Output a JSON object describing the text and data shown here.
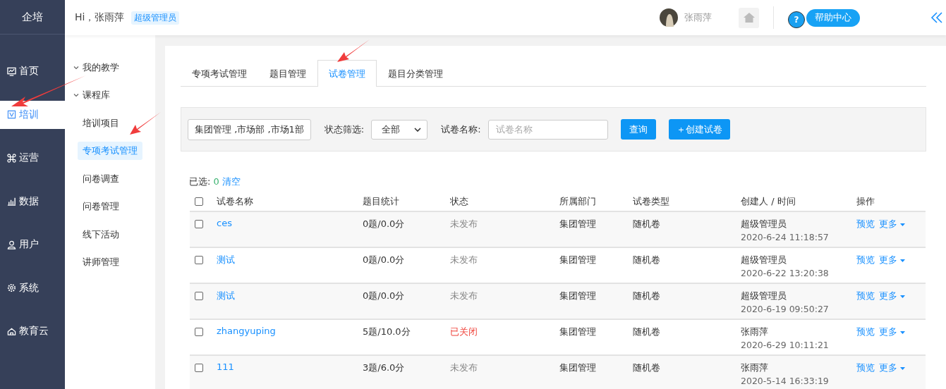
{
  "logo": "企培",
  "header": {
    "greeting": "Hi，张雨萍",
    "role_badge": "超级管理员",
    "user_name": "张雨萍",
    "help_mark": "?",
    "help": "帮助中心"
  },
  "nav": [
    {
      "label": "首页",
      "selected": false
    },
    {
      "label": "培训",
      "selected": true
    },
    {
      "label": "运营",
      "selected": false
    },
    {
      "label": "数据",
      "selected": false
    },
    {
      "label": "用户",
      "selected": false
    },
    {
      "label": "系统",
      "selected": false
    },
    {
      "label": "教育云",
      "selected": false
    }
  ],
  "subnav": [
    {
      "label": "我的教学",
      "expanded": true
    },
    {
      "label": "课程库",
      "expanded": true,
      "children": [
        {
          "label": "培训项目",
          "selected": false
        },
        {
          "label": "专项考试管理",
          "selected": true
        },
        {
          "label": "问卷调查",
          "selected": false
        },
        {
          "label": "问卷管理",
          "selected": false
        },
        {
          "label": "线下活动",
          "selected": false
        },
        {
          "label": "讲师管理",
          "selected": false
        }
      ]
    }
  ],
  "tabs": [
    {
      "label": "专项考试管理",
      "selected": false
    },
    {
      "label": "题目管理",
      "selected": false
    },
    {
      "label": "试卷管理",
      "selected": true
    },
    {
      "label": "题目分类管理",
      "selected": false
    }
  ],
  "filters": {
    "department": "集团管理 ,市场部 ,市场1部",
    "status_label": "状态筛选:",
    "status_value": "全部",
    "name_label": "试卷名称:",
    "name_placeholder": "试卷名称",
    "query_button": "查询",
    "create_button": "＋创建试卷"
  },
  "selection": {
    "label": "已选:",
    "count": "0",
    "clear": "清空"
  },
  "table": {
    "select_all_checked": false,
    "columns": [
      "试卷名称",
      "题目统计",
      "状态",
      "所属部门",
      "试卷类型",
      "创建人 / 时间",
      "操作"
    ],
    "rows": [
      {
        "checked": false,
        "name": "ces",
        "stats": "0题/0.0分",
        "status": "未发布",
        "color": "#888888",
        "dept": "集团管理",
        "type": "随机卷",
        "creator": "超级管理员",
        "time": "2020-6-24 11:18:57",
        "preview": "预览",
        "more": "更多"
      },
      {
        "checked": false,
        "name": "测试",
        "stats": "0题/0.0分",
        "status": "未发布",
        "color": "#888888",
        "dept": "集团管理",
        "type": "随机卷",
        "creator": "超级管理员",
        "time": "2020-6-22 13:20:38",
        "preview": "预览",
        "more": "更多"
      },
      {
        "checked": false,
        "name": "测试",
        "stats": "0题/0.0分",
        "status": "未发布",
        "color": "#888888",
        "dept": "集团管理",
        "type": "随机卷",
        "creator": "超级管理员",
        "time": "2020-6-19 09:50:27",
        "preview": "预览",
        "more": "更多"
      },
      {
        "checked": false,
        "name": "zhangyuping",
        "stats": "5题/10.0分",
        "status": "已关闭",
        "color": "#f0443c",
        "dept": "集团管理",
        "type": "随机卷",
        "creator": "张雨萍",
        "time": "2020-6-29 10:11:21",
        "preview": "预览",
        "more": "更多"
      },
      {
        "checked": false,
        "name": "111",
        "stats": "3题/6.0分",
        "status": "未发布",
        "color": "#888888",
        "dept": "集团管理",
        "type": "随机卷",
        "creator": "张雨萍",
        "time": "2020-5-14 16:33:19",
        "preview": "预览",
        "more": "更多"
      }
    ]
  }
}
